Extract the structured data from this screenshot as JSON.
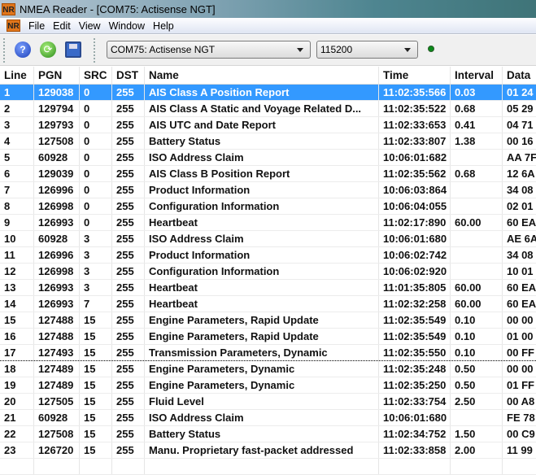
{
  "window": {
    "title": "NMEA Reader - [COM75: Actisense NGT]",
    "logo": "NR"
  },
  "menu": [
    "File",
    "Edit",
    "View",
    "Window",
    "Help"
  ],
  "toolbar": {
    "port": "COM75: Actisense NGT",
    "baud": "115200",
    "icons": [
      "help-icon",
      "refresh-icon",
      "save-icon"
    ],
    "status_led_color": "#0a8a1a"
  },
  "columns": [
    "Line",
    "PGN",
    "SRC",
    "DST",
    "Name",
    "Time",
    "Interval",
    "Data"
  ],
  "rows": [
    [
      "1",
      "129038",
      "0",
      "255",
      "AIS Class A Position Report",
      "11:02:35:566",
      "0.03",
      "01 24"
    ],
    [
      "2",
      "129794",
      "0",
      "255",
      "AIS Class A Static and Voyage Related D...",
      "11:02:35:522",
      "0.68",
      "05 29"
    ],
    [
      "3",
      "129793",
      "0",
      "255",
      "AIS UTC and Date Report",
      "11:02:33:653",
      "0.41",
      "04 71"
    ],
    [
      "4",
      "127508",
      "0",
      "255",
      "Battery Status",
      "11:02:33:807",
      "1.38",
      "00 16"
    ],
    [
      "5",
      "60928",
      "0",
      "255",
      "ISO Address Claim",
      "10:06:01:682",
      "",
      "AA 7F"
    ],
    [
      "6",
      "129039",
      "0",
      "255",
      "AIS Class B Position Report",
      "11:02:35:562",
      "0.68",
      "12 6A"
    ],
    [
      "7",
      "126996",
      "0",
      "255",
      "Product Information",
      "10:06:03:864",
      "",
      "34 08"
    ],
    [
      "8",
      "126998",
      "0",
      "255",
      "Configuration Information",
      "10:06:04:055",
      "",
      "02 01"
    ],
    [
      "9",
      "126993",
      "0",
      "255",
      "Heartbeat",
      "11:02:17:890",
      "60.00",
      "60 EA"
    ],
    [
      "10",
      "60928",
      "3",
      "255",
      "ISO Address Claim",
      "10:06:01:680",
      "",
      "AE 6A"
    ],
    [
      "11",
      "126996",
      "3",
      "255",
      "Product Information",
      "10:06:02:742",
      "",
      "34 08"
    ],
    [
      "12",
      "126998",
      "3",
      "255",
      "Configuration Information",
      "10:06:02:920",
      "",
      "10 01"
    ],
    [
      "13",
      "126993",
      "3",
      "255",
      "Heartbeat",
      "11:01:35:805",
      "60.00",
      "60 EA"
    ],
    [
      "14",
      "126993",
      "7",
      "255",
      "Heartbeat",
      "11:02:32:258",
      "60.00",
      "60 EA"
    ],
    [
      "15",
      "127488",
      "15",
      "255",
      "Engine Parameters, Rapid Update",
      "11:02:35:549",
      "0.10",
      "00 00"
    ],
    [
      "16",
      "127488",
      "15",
      "255",
      "Engine Parameters, Rapid Update",
      "11:02:35:549",
      "0.10",
      "01 00"
    ],
    [
      "17",
      "127493",
      "15",
      "255",
      "Transmission Parameters, Dynamic",
      "11:02:35:550",
      "0.10",
      "00 FF"
    ],
    [
      "18",
      "127489",
      "15",
      "255",
      "Engine Parameters, Dynamic",
      "11:02:35:248",
      "0.50",
      "00 00"
    ],
    [
      "19",
      "127489",
      "15",
      "255",
      "Engine Parameters, Dynamic",
      "11:02:35:250",
      "0.50",
      "01 FF"
    ],
    [
      "20",
      "127505",
      "15",
      "255",
      "Fluid Level",
      "11:02:33:754",
      "2.50",
      "00 A8"
    ],
    [
      "21",
      "60928",
      "15",
      "255",
      "ISO Address Claim",
      "10:06:01:680",
      "",
      "FE 78"
    ],
    [
      "22",
      "127508",
      "15",
      "255",
      "Battery Status",
      "11:02:34:752",
      "1.50",
      "00 C9"
    ],
    [
      "23",
      "126720",
      "15",
      "255",
      "Manu. Proprietary fast-packet addressed",
      "11:02:33:858",
      "2.00",
      "11 99"
    ]
  ],
  "selected_row": 0,
  "focus_row": 16
}
